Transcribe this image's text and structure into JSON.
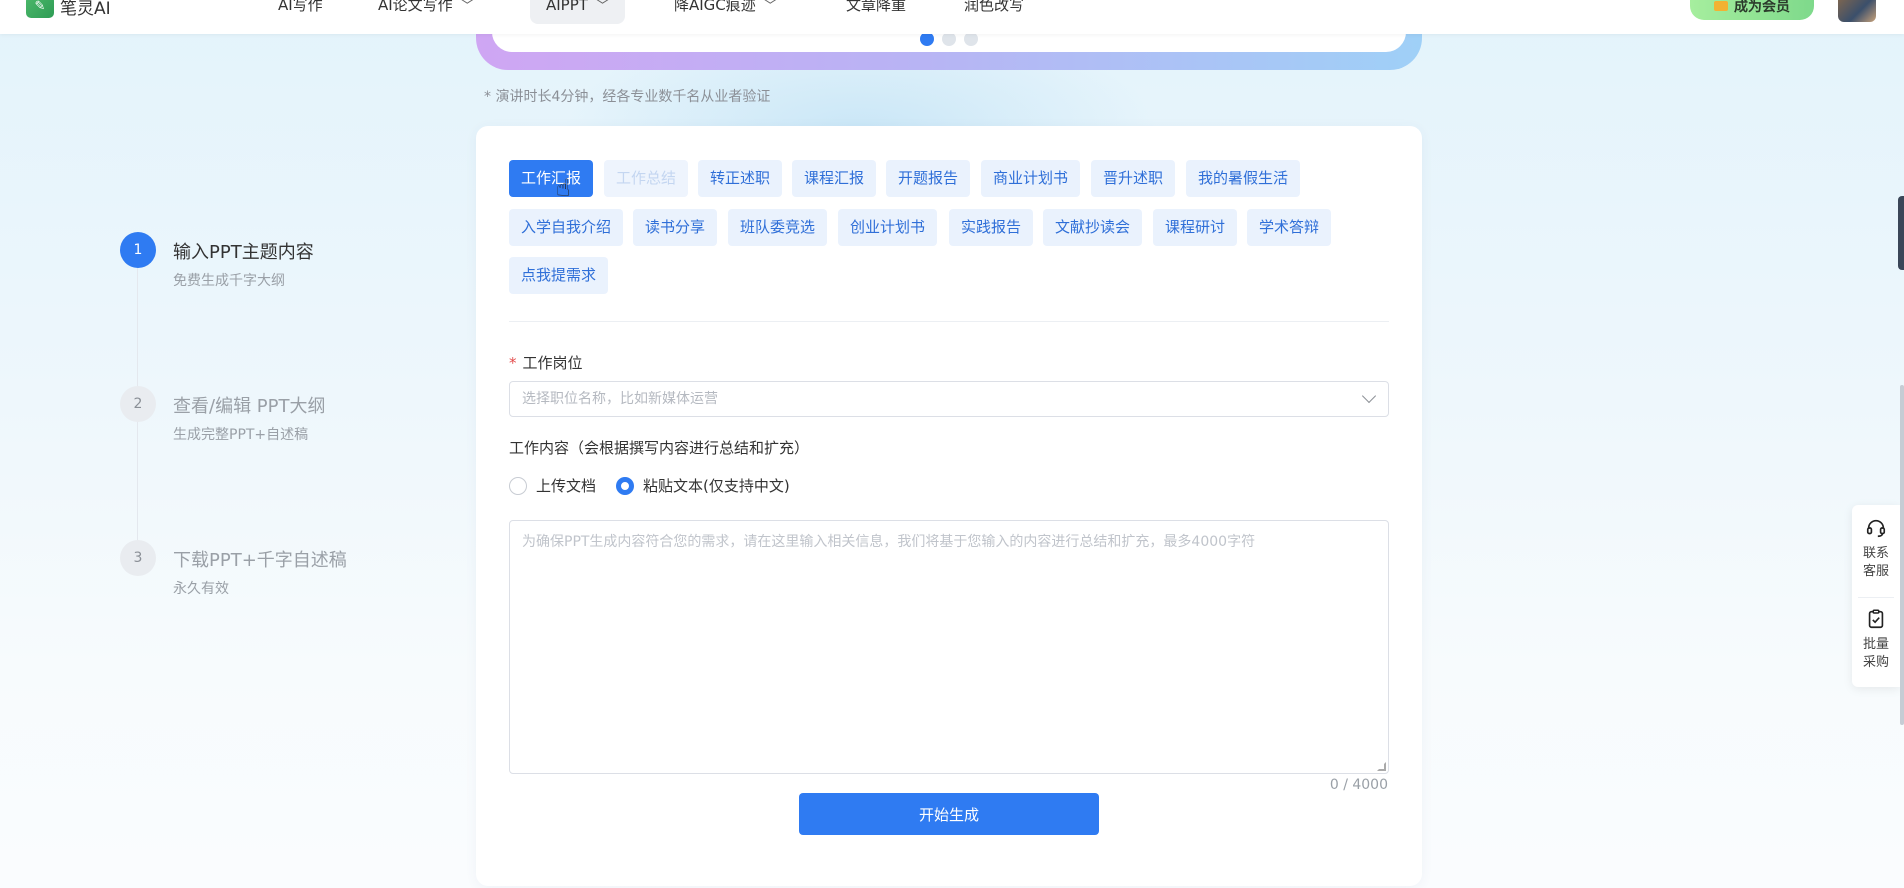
{
  "brand": {
    "name": "笔灵AI"
  },
  "nav": {
    "items": [
      {
        "label": "AI写作",
        "dropdown": false,
        "active": false
      },
      {
        "label": "AI论文写作",
        "dropdown": true,
        "active": false
      },
      {
        "label": "AIPPT",
        "dropdown": true,
        "active": true
      },
      {
        "label": "降AIGC痕迹",
        "dropdown": true,
        "active": false
      },
      {
        "label": "文章降重",
        "dropdown": false,
        "active": false
      },
      {
        "label": "润色改写",
        "dropdown": false,
        "active": false
      }
    ],
    "member_button": "成为会员"
  },
  "carousel": {
    "page_count": 3,
    "active_index": 0
  },
  "note": "* 演讲时长4分钟，经各专业数千名从业者验证",
  "steps": [
    {
      "number": "1",
      "title": "输入PPT主题内容",
      "subtitle": "免费生成千字大纲",
      "active": true
    },
    {
      "number": "2",
      "title": "查看/编辑 PPT大纲",
      "subtitle": "生成完整PPT+自述稿",
      "active": false
    },
    {
      "number": "3",
      "title": "下载PPT+千字自述稿",
      "subtitle": "永久有效",
      "active": false
    }
  ],
  "templates": {
    "selected": "工作汇报",
    "tags": [
      "工作汇报",
      "工作总结",
      "转正述职",
      "课程汇报",
      "开题报告",
      "商业计划书",
      "晋升述职",
      "我的暑假生活",
      "入学自我介绍",
      "读书分享",
      "班队委竞选",
      "创业计划书",
      "实践报告",
      "文献抄读会",
      "课程研讨",
      "学术答辩",
      "点我提需求"
    ]
  },
  "form": {
    "position": {
      "required_mark": "*",
      "label": "工作岗位",
      "placeholder": "选择职位名称，比如新媒体运营"
    },
    "content": {
      "label": "工作内容（会根据撰写内容进行总结和扩充）",
      "options": [
        "上传文档",
        "粘贴文本(仅支持中文)"
      ],
      "selected_option": "粘贴文本(仅支持中文)",
      "placeholder": "为确保PPT生成内容符合您的需求，请在这里输入相关信息，我们将基于您输入的内容进行总结和扩充，最多4000字符",
      "counter": "0 / 4000"
    },
    "submit_label": "开始生成"
  },
  "side_panel": {
    "items": [
      {
        "label_line1": "联系",
        "label_line2": "客服",
        "icon": "headset-icon"
      },
      {
        "label_line1": "批量",
        "label_line2": "采购",
        "icon": "clipboard-check-icon"
      }
    ]
  },
  "colors": {
    "primary": "#2f7bf2",
    "tag_bg": "#eaf2fd",
    "member_green": "#8fe394"
  }
}
